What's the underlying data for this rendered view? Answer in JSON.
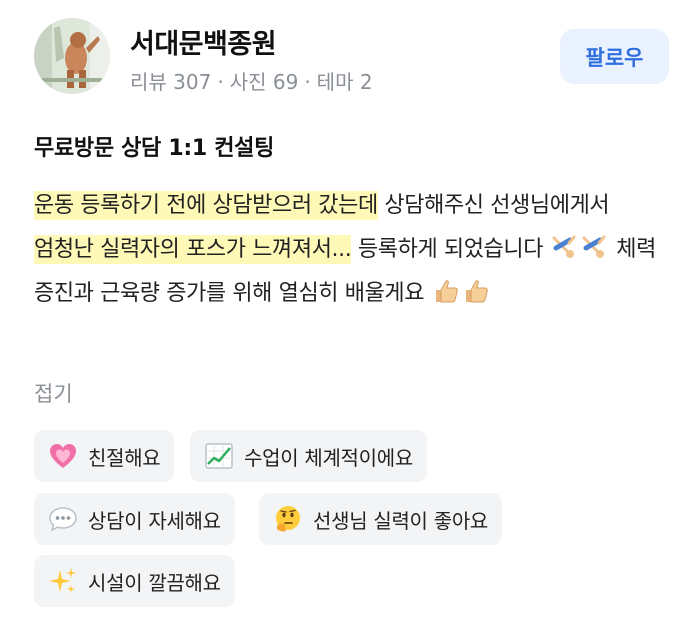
{
  "profile": {
    "name": "서대문백종원",
    "stats": {
      "reviews": "리뷰 307",
      "photos": "사진 69",
      "themes": "테마 2",
      "separator": "·"
    },
    "follow_label": "팔로우"
  },
  "review": {
    "title": "무료방문 상담 1:1 컨설팅",
    "segments": [
      {
        "text": "운동 등록하기 전에 상담받으러 갔는데",
        "highlight": true
      },
      {
        "text": " 상담해주신 선생님에게서 ",
        "highlight": false
      },
      {
        "text": "엄청난 실력자의 포스가 느껴져서...",
        "highlight": true
      },
      {
        "text": " 등록하게 되었습니다 ",
        "highlight": false
      },
      {
        "text": " 체력 증진과 근육량 증가를 위해 열심히 배울게요 ",
        "highlight": false
      }
    ],
    "collapse_label": "접기"
  },
  "keywords": [
    {
      "icon": "heart-icon",
      "label": "친절해요"
    },
    {
      "icon": "chart-up-icon",
      "label": "수업이 체계적이에요"
    },
    {
      "icon": "speech-bubble-icon",
      "label": "상담이 자세해요"
    },
    {
      "icon": "thinking-face-icon",
      "label": "선생님 실력이 좋아요"
    },
    {
      "icon": "sparkles-icon",
      "label": "시설이 깔끔해요"
    }
  ],
  "colors": {
    "highlight": "#fff9b8",
    "follow_bg": "#eaf2ff",
    "follow_text": "#2f6fde",
    "muted_text": "#8a8f96",
    "chip_bg": "#f3f4f6"
  }
}
